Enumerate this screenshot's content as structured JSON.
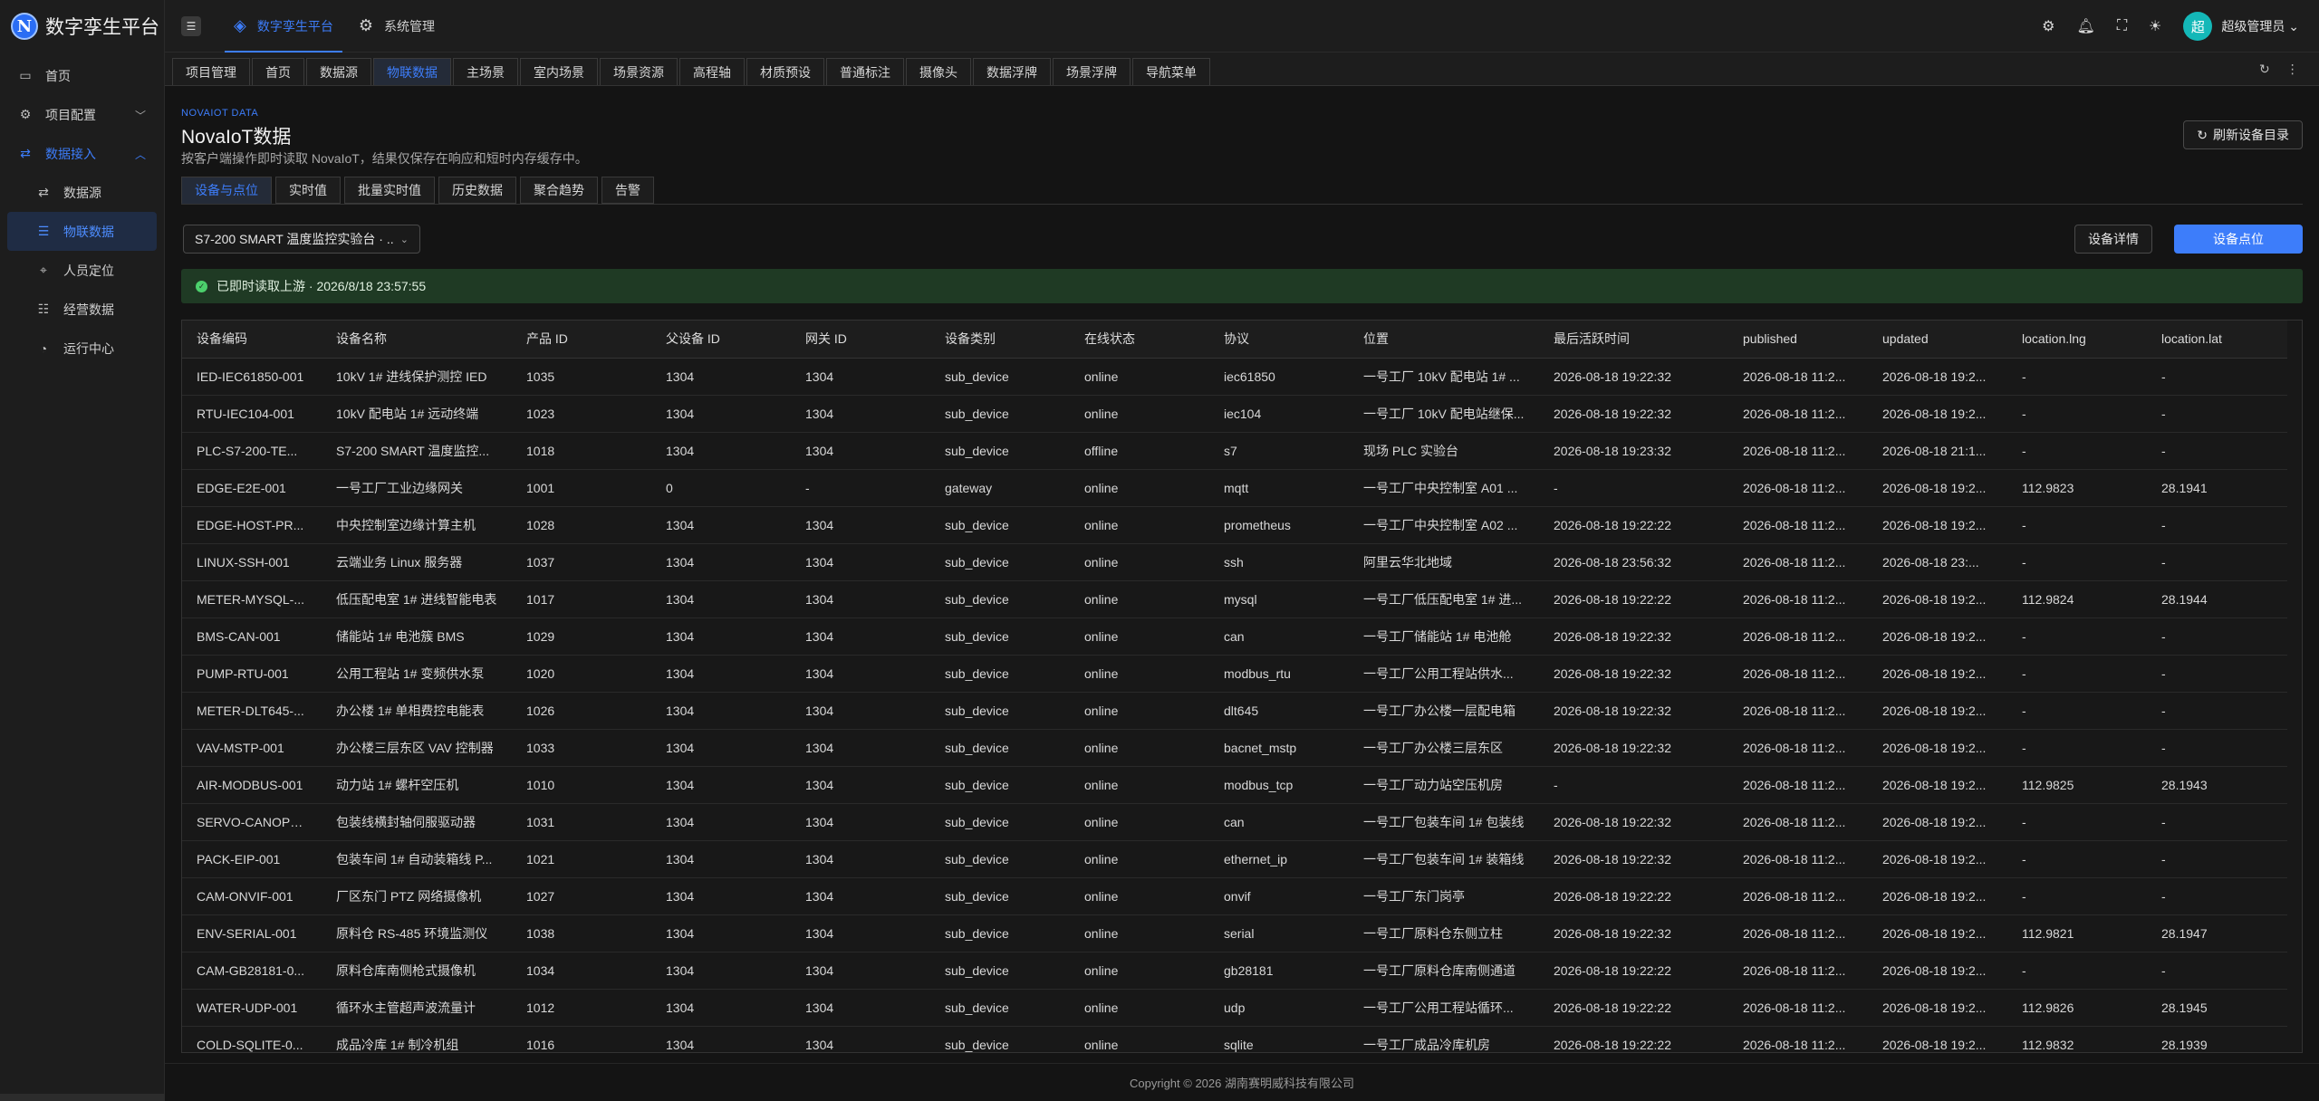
{
  "app": {
    "logo_letter": "N",
    "title": "数字孪生平台"
  },
  "sidebar": {
    "items": [
      {
        "label": "首页",
        "icon": "monitor-icon",
        "glyph": "▭",
        "level": 0,
        "state": ""
      },
      {
        "label": "项目配置",
        "icon": "gear-icon",
        "glyph": "⚙",
        "level": 0,
        "state": "collapsed"
      },
      {
        "label": "数据接入",
        "icon": "exchange-icon",
        "glyph": "⇄",
        "level": 0,
        "state": "open"
      },
      {
        "label": "数据源",
        "icon": "exchange-icon",
        "glyph": "⇄",
        "level": 1,
        "state": ""
      },
      {
        "label": "物联数据",
        "icon": "list-icon",
        "glyph": "☰",
        "level": 1,
        "state": "active"
      },
      {
        "label": "人员定位",
        "icon": "location-icon",
        "glyph": "⌖",
        "level": 1,
        "state": ""
      },
      {
        "label": "经营数据",
        "icon": "list-icon",
        "glyph": "☷",
        "level": 1,
        "state": ""
      },
      {
        "label": "运行中心",
        "icon": "gauge-icon",
        "glyph": "◔",
        "level": 1,
        "state": ""
      }
    ]
  },
  "header": {
    "nav": [
      {
        "label": "数字孪生平台",
        "icon": "layers-icon",
        "glyph": "◈",
        "active": true
      },
      {
        "label": "系统管理",
        "icon": "gear-icon",
        "glyph": "⚙",
        "active": false
      }
    ],
    "user": {
      "avatar": "超",
      "name": "超级管理员"
    }
  },
  "page_tabs": [
    "项目管理",
    "首页",
    "数据源",
    "物联数据",
    "主场景",
    "室内场景",
    "场景资源",
    "高程轴",
    "材质预设",
    "普通标注",
    "摄像头",
    "数据浮牌",
    "场景浮牌",
    "导航菜单"
  ],
  "page_tabs_active": 3,
  "page": {
    "label": "NOVAIOT DATA",
    "title": "NovaIoT数据",
    "desc": "按客户端操作即时读取 NovaIoT，结果仅保存在响应和短时内存缓存中。",
    "refresh_label": "刷新设备目录"
  },
  "sub_tabs": [
    "设备与点位",
    "实时值",
    "批量实时值",
    "历史数据",
    "聚合趋势",
    "告警"
  ],
  "sub_tabs_active": 0,
  "device_select": {
    "value": "S7-200 SMART 温度监控实验台 · ..."
  },
  "buttons": {
    "detail": "设备详情",
    "points": "设备点位"
  },
  "status": {
    "text": "已即时读取上游 · 2026/8/18 23:57:55"
  },
  "table": {
    "columns": [
      "设备编码",
      "设备名称",
      "产品 ID",
      "父设备 ID",
      "网关 ID",
      "设备类别",
      "在线状态",
      "协议",
      "位置",
      "最后活跃时间",
      "published",
      "updated",
      "location.lng",
      "location.lat"
    ],
    "rows": [
      [
        "IED-IEC61850-001",
        "10kV 1# 进线保护测控 IED",
        "1035",
        "1304",
        "1304",
        "sub_device",
        "online",
        "iec61850",
        "一号工厂 10kV 配电站 1# ...",
        "2026-08-18 19:22:32",
        "2026-08-18 11:2...",
        "2026-08-18 19:2...",
        "-",
        "-"
      ],
      [
        "RTU-IEC104-001",
        "10kV 配电站 1# 远动终端",
        "1023",
        "1304",
        "1304",
        "sub_device",
        "online",
        "iec104",
        "一号工厂 10kV 配电站继保...",
        "2026-08-18 19:22:32",
        "2026-08-18 11:2...",
        "2026-08-18 19:2...",
        "-",
        "-"
      ],
      [
        "PLC-S7-200-TE...",
        "S7-200 SMART 温度监控...",
        "1018",
        "1304",
        "1304",
        "sub_device",
        "offline",
        "s7",
        "现场 PLC 实验台",
        "2026-08-18 19:23:32",
        "2026-08-18 11:2...",
        "2026-08-18 21:1...",
        "-",
        "-"
      ],
      [
        "EDGE-E2E-001",
        "一号工厂工业边缘网关",
        "1001",
        "0",
        "-",
        "gateway",
        "online",
        "mqtt",
        "一号工厂中央控制室 A01 ...",
        "-",
        "2026-08-18 11:2...",
        "2026-08-18 19:2...",
        "112.9823",
        "28.1941"
      ],
      [
        "EDGE-HOST-PR...",
        "中央控制室边缘计算主机",
        "1028",
        "1304",
        "1304",
        "sub_device",
        "online",
        "prometheus",
        "一号工厂中央控制室 A02 ...",
        "2026-08-18 19:22:22",
        "2026-08-18 11:2...",
        "2026-08-18 19:2...",
        "-",
        "-"
      ],
      [
        "LINUX-SSH-001",
        "云端业务 Linux 服务器",
        "1037",
        "1304",
        "1304",
        "sub_device",
        "online",
        "ssh",
        "阿里云华北地域",
        "2026-08-18 23:56:32",
        "2026-08-18 11:2...",
        "2026-08-18 23:...",
        "-",
        "-"
      ],
      [
        "METER-MYSQL-...",
        "低压配电室 1# 进线智能电表",
        "1017",
        "1304",
        "1304",
        "sub_device",
        "online",
        "mysql",
        "一号工厂低压配电室 1# 进...",
        "2026-08-18 19:22:22",
        "2026-08-18 11:2...",
        "2026-08-18 19:2...",
        "112.9824",
        "28.1944"
      ],
      [
        "BMS-CAN-001",
        "储能站 1# 电池簇 BMS",
        "1029",
        "1304",
        "1304",
        "sub_device",
        "online",
        "can",
        "一号工厂储能站 1# 电池舱",
        "2026-08-18 19:22:32",
        "2026-08-18 11:2...",
        "2026-08-18 19:2...",
        "-",
        "-"
      ],
      [
        "PUMP-RTU-001",
        "公用工程站 1# 变频供水泵",
        "1020",
        "1304",
        "1304",
        "sub_device",
        "online",
        "modbus_rtu",
        "一号工厂公用工程站供水...",
        "2026-08-18 19:22:32",
        "2026-08-18 11:2...",
        "2026-08-18 19:2...",
        "-",
        "-"
      ],
      [
        "METER-DLT645-...",
        "办公楼 1# 单相费控电能表",
        "1026",
        "1304",
        "1304",
        "sub_device",
        "online",
        "dlt645",
        "一号工厂办公楼一层配电箱",
        "2026-08-18 19:22:32",
        "2026-08-18 11:2...",
        "2026-08-18 19:2...",
        "-",
        "-"
      ],
      [
        "VAV-MSTP-001",
        "办公楼三层东区 VAV 控制器",
        "1033",
        "1304",
        "1304",
        "sub_device",
        "online",
        "bacnet_mstp",
        "一号工厂办公楼三层东区",
        "2026-08-18 19:22:32",
        "2026-08-18 11:2...",
        "2026-08-18 19:2...",
        "-",
        "-"
      ],
      [
        "AIR-MODBUS-001",
        "动力站 1# 螺杆空压机",
        "1010",
        "1304",
        "1304",
        "sub_device",
        "online",
        "modbus_tcp",
        "一号工厂动力站空压机房",
        "-",
        "2026-08-18 11:2...",
        "2026-08-18 19:2...",
        "112.9825",
        "28.1943"
      ],
      [
        "SERVO-CANOPE...",
        "包装线横封轴伺服驱动器",
        "1031",
        "1304",
        "1304",
        "sub_device",
        "online",
        "can",
        "一号工厂包装车间 1# 包装线",
        "2026-08-18 19:22:32",
        "2026-08-18 11:2...",
        "2026-08-18 19:2...",
        "-",
        "-"
      ],
      [
        "PACK-EIP-001",
        "包装车间 1# 自动装箱线 P...",
        "1021",
        "1304",
        "1304",
        "sub_device",
        "online",
        "ethernet_ip",
        "一号工厂包装车间 1# 装箱线",
        "2026-08-18 19:22:32",
        "2026-08-18 11:2...",
        "2026-08-18 19:2...",
        "-",
        "-"
      ],
      [
        "CAM-ONVIF-001",
        "厂区东门 PTZ 网络摄像机",
        "1027",
        "1304",
        "1304",
        "sub_device",
        "online",
        "onvif",
        "一号工厂东门岗亭",
        "2026-08-18 19:22:22",
        "2026-08-18 11:2...",
        "2026-08-18 19:2...",
        "-",
        "-"
      ],
      [
        "ENV-SERIAL-001",
        "原料仓 RS-485 环境监测仪",
        "1038",
        "1304",
        "1304",
        "sub_device",
        "online",
        "serial",
        "一号工厂原料仓东侧立柱",
        "2026-08-18 19:22:32",
        "2026-08-18 11:2...",
        "2026-08-18 19:2...",
        "112.9821",
        "28.1947"
      ],
      [
        "CAM-GB28181-0...",
        "原料仓库南侧枪式摄像机",
        "1034",
        "1304",
        "1304",
        "sub_device",
        "online",
        "gb28181",
        "一号工厂原料仓库南侧通道",
        "2026-08-18 19:22:22",
        "2026-08-18 11:2...",
        "2026-08-18 19:2...",
        "-",
        "-"
      ],
      [
        "WATER-UDP-001",
        "循环水主管超声波流量计",
        "1012",
        "1304",
        "1304",
        "sub_device",
        "online",
        "udp",
        "一号工厂公用工程站循环...",
        "2026-08-18 19:22:22",
        "2026-08-18 11:2...",
        "2026-08-18 19:2...",
        "112.9826",
        "28.1945"
      ],
      [
        "COLD-SQLITE-0...",
        "成品冷库 1# 制冷机组",
        "1016",
        "1304",
        "1304",
        "sub_device",
        "online",
        "sqlite",
        "一号工厂成品冷库机房",
        "2026-08-18 19:22:22",
        "2026-08-18 11:2...",
        "2026-08-18 19:2...",
        "112.9832",
        "28.1939"
      ]
    ]
  },
  "footer": {
    "text": "Copyright © 2026 湖南赛明威科技有限公司"
  }
}
